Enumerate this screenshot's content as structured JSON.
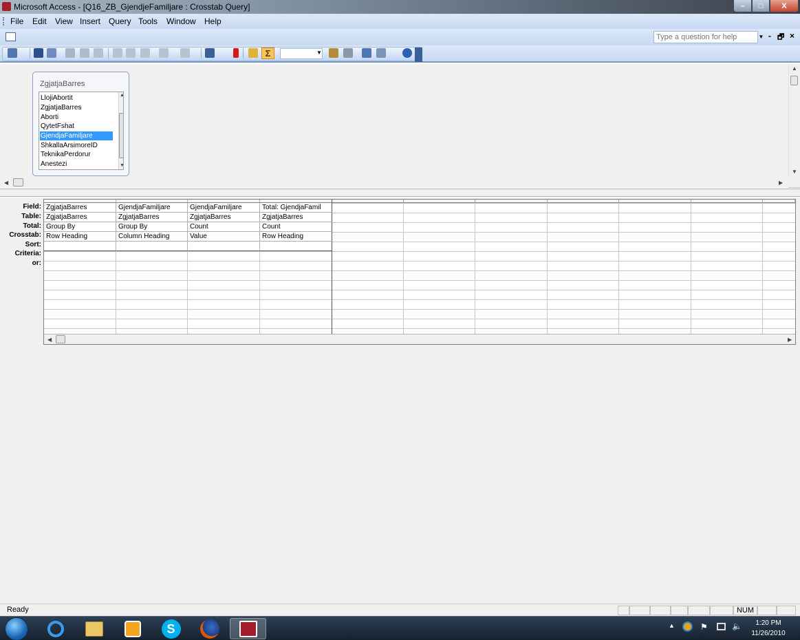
{
  "window": {
    "title": "Microsoft Access - [Q16_ZB_GjendjeFamiljare : Crosstab Query]",
    "min_label": "–",
    "max_label": "□",
    "close_label": "X"
  },
  "menu": {
    "items": [
      "File",
      "Edit",
      "View",
      "Insert",
      "Query",
      "Tools",
      "Window",
      "Help"
    ]
  },
  "helpbox": {
    "placeholder": "Type a question for help"
  },
  "mdi_controls": {
    "min": "-",
    "restore": "🗗",
    "close": "×"
  },
  "toolbar": {
    "icons": [
      "view-icon",
      "save-icon",
      "search-icon",
      "print-icon",
      "print-preview-icon",
      "spelling-icon",
      "cut-icon",
      "copy-icon",
      "paste-icon",
      "undo-icon",
      "redo-icon",
      "query-type-icon",
      "run-icon",
      "show-table-icon",
      "totals-icon",
      "top-values-combo",
      "properties-icon",
      "build-icon",
      "database-window-icon",
      "new-object-icon",
      "help-icon"
    ],
    "totals_active": true
  },
  "field_list": {
    "title": "ZgjatjaBarres",
    "items": [
      "LlojiAbortit",
      "ZgjatjaBarres",
      "Aborti",
      "QytetFshat",
      "GjendjaFamiljare",
      "ShkallaArsimoreID",
      "TeknikaPerdorur",
      "Anestezi"
    ],
    "selected": "GjendjaFamiljare"
  },
  "grid": {
    "row_labels": [
      "Field:",
      "Table:",
      "Total:",
      "Crosstab:",
      "Sort:",
      "Criteria:",
      "or:"
    ],
    "columns": [
      {
        "field": "ZgjatjaBarres",
        "table": "ZgjatjaBarres",
        "total": "Group By",
        "crosstab": "Row Heading",
        "sort": ""
      },
      {
        "field": "GjendjaFamiljare",
        "table": "ZgjatjaBarres",
        "total": "Group By",
        "crosstab": "Column Heading",
        "sort": ""
      },
      {
        "field": "GjendjaFamiljare",
        "table": "ZgjatjaBarres",
        "total": "Count",
        "crosstab": "Value",
        "sort": ""
      },
      {
        "field": "Total: GjendjaFamil",
        "table": "ZgjatjaBarres",
        "total": "Count",
        "crosstab": "Row Heading",
        "sort": ""
      }
    ]
  },
  "status": {
    "text": "Ready",
    "num": "NUM"
  },
  "taskbar": {
    "apps": [
      "internet-explorer",
      "windows-explorer",
      "media-player",
      "skype",
      "firefox",
      "microsoft-access"
    ],
    "active_app": "microsoft-access",
    "time": "1:20 PM",
    "date": "11/26/2010"
  }
}
